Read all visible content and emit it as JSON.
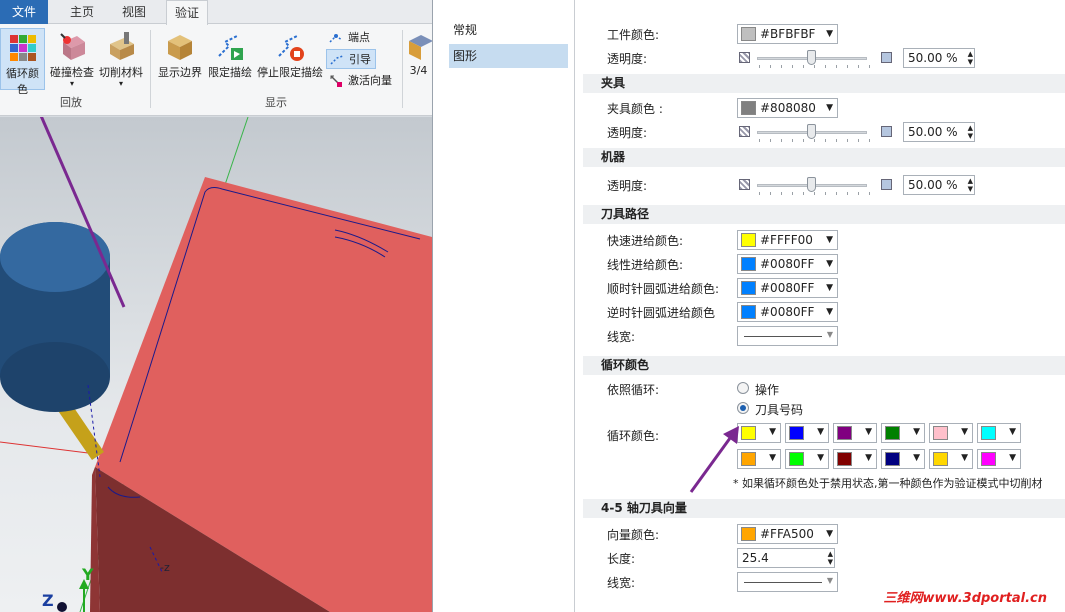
{
  "ribbon": {
    "tabs": [
      "文件",
      "主页",
      "视图",
      "验证"
    ],
    "buttons": {
      "cycle_color": "循环颜色",
      "collision_check": "碰撞检查",
      "cut_material": "切削材料",
      "show_boundary": "显示边界",
      "limit_sketch": "限定描绘",
      "stop_limit_sketch": "停止限定描绘",
      "endpoint": "端点",
      "lead": "引导",
      "activate_vector": "激活向量",
      "partial": "3/4"
    },
    "groups": {
      "playback": "回放",
      "display": "显示"
    }
  },
  "dialog": {
    "nav": [
      "常规",
      "图形"
    ],
    "workpiece": {
      "color_label": "工件颜色:",
      "color_value": "#BFBFBF",
      "color": "#BFBFBF",
      "transparency_label": "透明度:",
      "transparency_value": "50.00 %"
    },
    "fixture": {
      "title": "夹具",
      "color_label": "夹具颜色 :",
      "color_value": "#808080",
      "color": "#808080",
      "transparency_label": "透明度:",
      "transparency_value": "50.00 %"
    },
    "machine": {
      "title": "机器",
      "transparency_label": "透明度:",
      "transparency_value": "50.00 %"
    },
    "toolpath": {
      "title": "刀具路径",
      "rapid_label": "快速进给颜色:",
      "rapid_value": "#FFFF00",
      "rapid_color": "#FFFF00",
      "linear_label": "线性进给颜色:",
      "linear_value": "#0080FF",
      "linear_color": "#0080FF",
      "cw_label": "顺时针圆弧进给颜色:",
      "cw_value": "#0080FF",
      "cw_color": "#0080FF",
      "ccw_label": "逆时针圆弧进给颜色",
      "ccw_value": "#0080FF",
      "ccw_color": "#0080FF",
      "width_label": "线宽:"
    },
    "cycle": {
      "title": "循环颜色",
      "by_label": "依照循环:",
      "opt_operation": "操作",
      "opt_tool_number": "刀具号码",
      "colors_label": "循环颜色:",
      "swatches": [
        "#FFFF00",
        "#0000FF",
        "#800080",
        "#008000",
        "#FFC0CB",
        "#00FFFF",
        "#FFA500",
        "#00FF00",
        "#800000",
        "#000080",
        "#FFD700",
        "#FF00FF"
      ],
      "note": "* 如果循环颜色处于禁用状态,第一种颜色作为验证模式中切削材"
    },
    "axis": {
      "title": "4-5 轴刀具向量",
      "vector_color_label": "向量颜色:",
      "vector_color_value": "#FFA500",
      "vector_color": "#FFA500",
      "length_label": "长度:",
      "length_value": "25.4",
      "width_label": "线宽:"
    }
  },
  "viewport": {
    "axis_y": "Y",
    "axis_z": "Z",
    "axis_minus_z": "-z"
  },
  "watermark": "三维网www.3dportal.cn"
}
